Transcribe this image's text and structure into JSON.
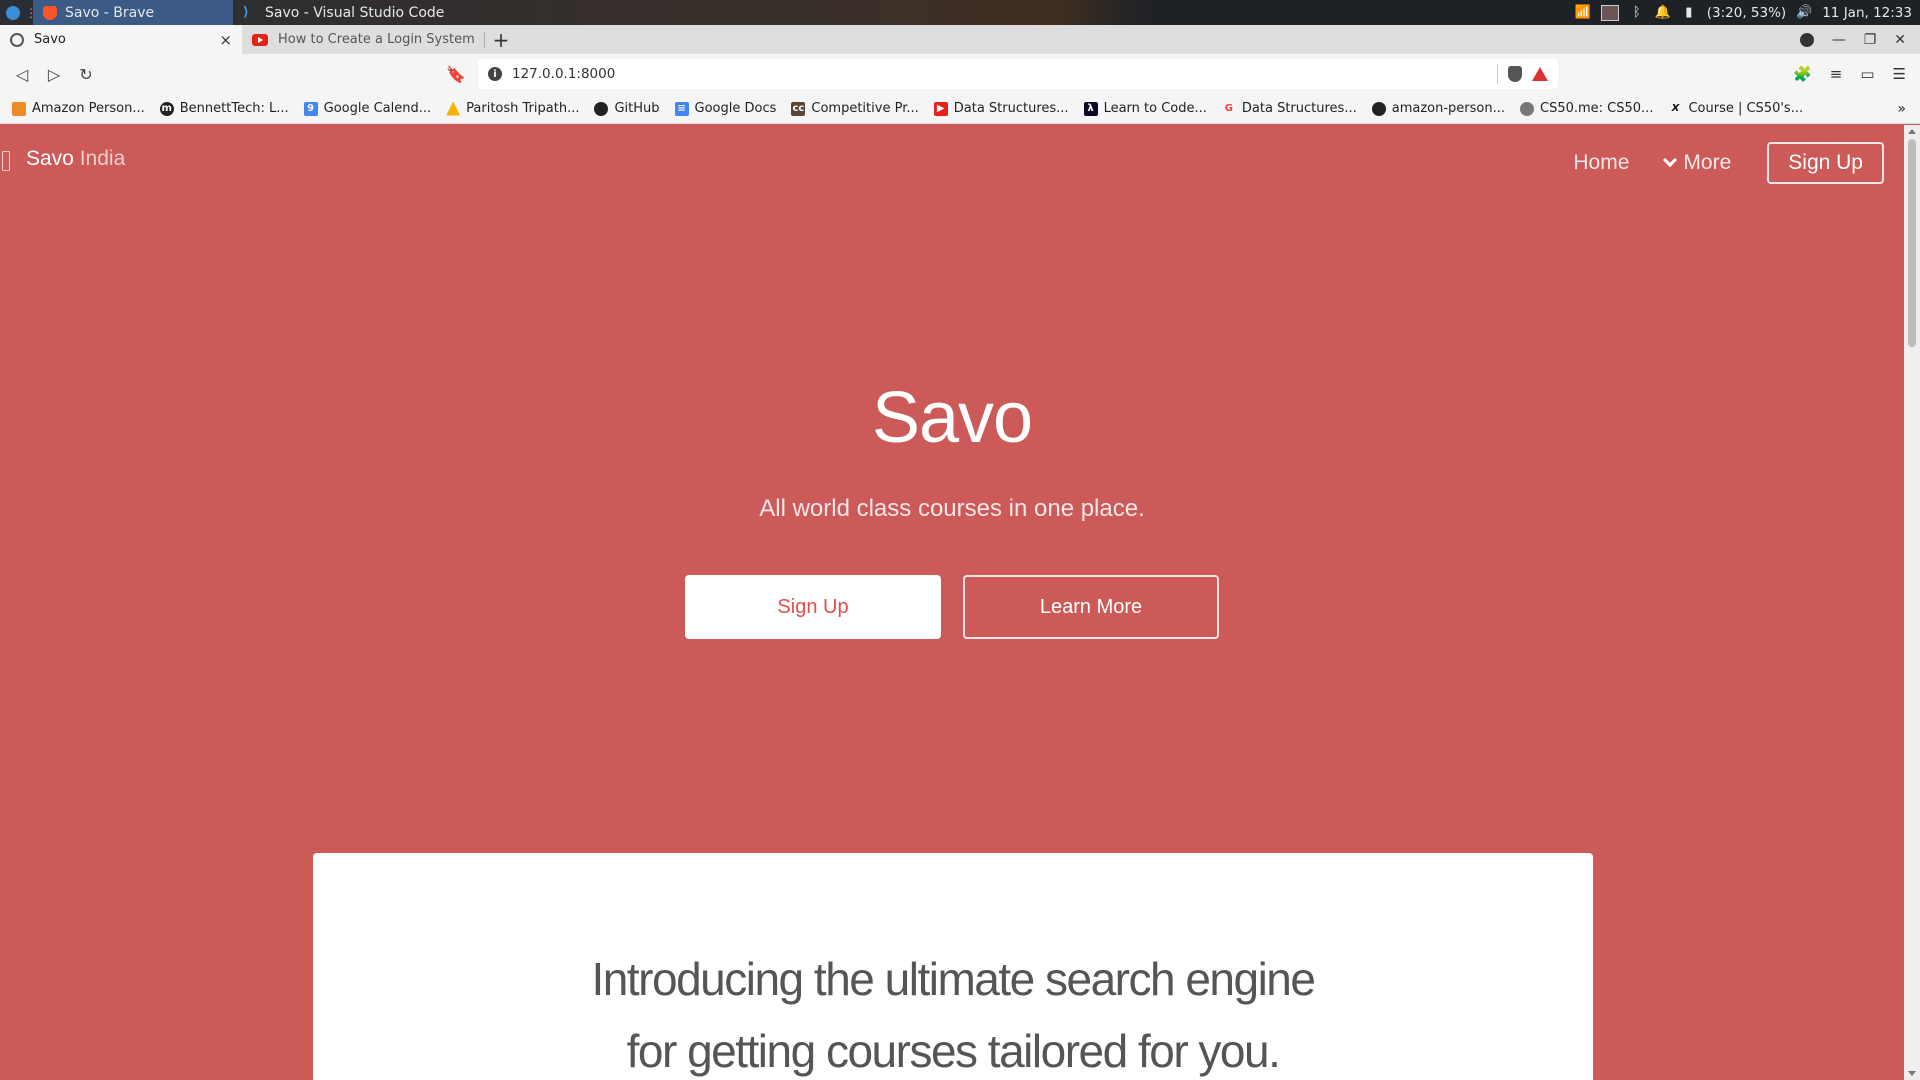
{
  "taskbar": {
    "active_window": "Savo - Brave",
    "inactive_window": "Savo - Visual Studio Code",
    "battery": "(3:20, 53%)",
    "clock": "11 Jan, 12:33"
  },
  "browser": {
    "tabs": [
      {
        "title": "Savo",
        "close": "×"
      },
      {
        "title": "How to Create a Login System"
      }
    ],
    "new_tab": "+",
    "url": "127.0.0.1:8000",
    "bookmarks": [
      {
        "label": "Amazon Person...",
        "icon": "amazon-icon",
        "color": "#f08a24"
      },
      {
        "label": "BennettTech: L...",
        "icon": "bennett-icon",
        "color": "#222222"
      },
      {
        "label": "Google Calend...",
        "icon": "calendar-icon",
        "color": "#4285f4"
      },
      {
        "label": "Paritosh Tripath...",
        "icon": "drive-icon",
        "color": "#f4b400"
      },
      {
        "label": "GitHub",
        "icon": "github-icon",
        "color": "#222222"
      },
      {
        "label": "Google Docs",
        "icon": "docs-icon",
        "color": "#4285f4"
      },
      {
        "label": "Competitive Pr...",
        "icon": "cc-icon",
        "color": "#5b4636"
      },
      {
        "label": "Data Structures...",
        "icon": "youtube-icon",
        "color": "#e62117"
      },
      {
        "label": "Learn to Code...",
        "icon": "fcc-icon",
        "color": "#0a0a23"
      },
      {
        "label": "Data Structures...",
        "icon": "google-icon",
        "color": "#ffffff"
      },
      {
        "label": "amazon-person...",
        "icon": "github-icon",
        "color": "#222222"
      },
      {
        "label": "CS50.me: CS50...",
        "icon": "globe-icon",
        "color": "#777777"
      },
      {
        "label": "Course | CS50's...",
        "icon": "edx-icon",
        "color": "#111111"
      }
    ],
    "bookmarks_more": "»"
  },
  "site": {
    "brand_main": "Savo",
    "brand_sub": "India",
    "nav": {
      "home": "Home",
      "more": "More",
      "signup": "Sign Up"
    },
    "hero": {
      "title": "Savo",
      "subtitle": "All world class courses in one place.",
      "primary_button": "Sign Up",
      "secondary_button": "Learn More"
    },
    "intro": {
      "line1": "Introducing the ultimate search engine",
      "line2": "for getting courses tailored for you."
    }
  },
  "colors": {
    "page_background": "#cb5a59",
    "primary_button_text": "#e24d4a"
  }
}
